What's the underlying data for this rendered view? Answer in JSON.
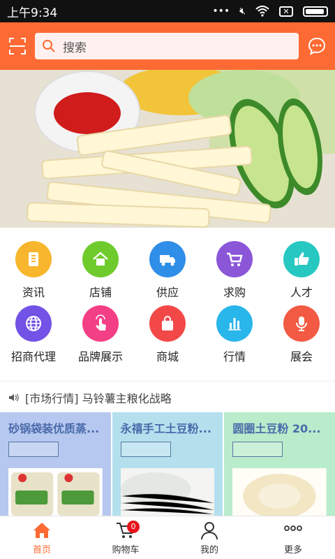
{
  "status": {
    "time": "上午9:34"
  },
  "search": {
    "placeholder": "搜索"
  },
  "categories": [
    {
      "label": "资讯",
      "color": "#f7b62d",
      "icon": "document-icon"
    },
    {
      "label": "店铺",
      "color": "#6fcb2c",
      "icon": "home-icon"
    },
    {
      "label": "供应",
      "color": "#2f8ee7",
      "icon": "truck-icon"
    },
    {
      "label": "求购",
      "color": "#8b56d8",
      "icon": "cart-icon"
    },
    {
      "label": "人才",
      "color": "#27c8c1",
      "icon": "thumbs-up-icon"
    },
    {
      "label": "招商代理",
      "color": "#7352e6",
      "icon": "globe-icon"
    },
    {
      "label": "品牌展示",
      "color": "#f33f86",
      "icon": "tap-icon"
    },
    {
      "label": "商城",
      "color": "#f24848",
      "icon": "bag-icon"
    },
    {
      "label": "行情",
      "color": "#29b6ea",
      "icon": "bar-chart-icon"
    },
    {
      "label": "展会",
      "color": "#f25a43",
      "icon": "microphone-icon"
    }
  ],
  "news": {
    "text": "[市场行情] 马铃薯主粮化战略"
  },
  "cards": [
    {
      "title": "砂锅袋装优质蒸...",
      "bg": "#b6c8ef"
    },
    {
      "title": "永禧手工土豆粉...",
      "bg": "#b4e0ee"
    },
    {
      "title": "圆圈土豆粉 20...",
      "bg": "#b9eccb"
    }
  ],
  "tabbar": {
    "home": "首页",
    "cart": "购物车",
    "cart_count": "0",
    "mine": "我的",
    "more": "更多"
  }
}
